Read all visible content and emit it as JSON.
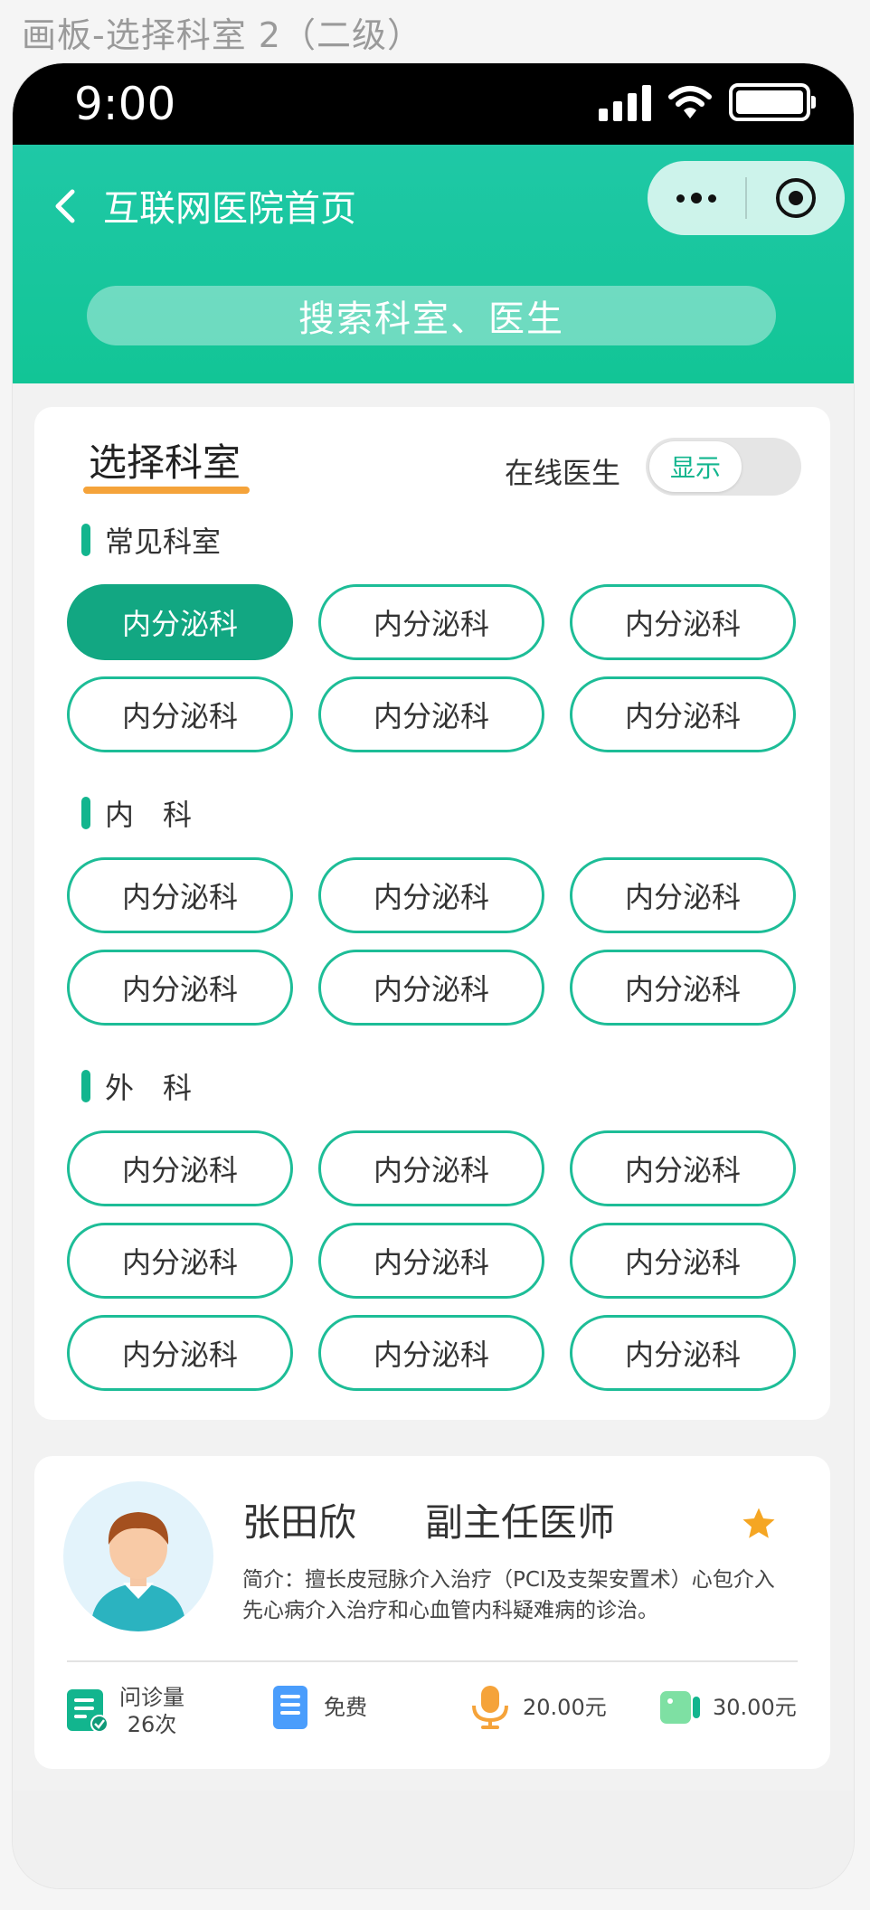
{
  "artboard": {
    "title": "画板-选择科室 2（二级）"
  },
  "status_bar": {
    "time": "9:00"
  },
  "nav": {
    "title": "互联网医院首页",
    "back_icon": "chevron-left-icon",
    "more_icon": "more-dots-icon",
    "close_icon": "target-circle-icon"
  },
  "search": {
    "placeholder": "搜索科室、医生"
  },
  "department": {
    "title": "选择科室",
    "online_label": "在线医生",
    "toggle_text": "显示",
    "sections": [
      {
        "label": "常见科室",
        "items": [
          "内分泌科",
          "内分泌科",
          "内分泌科",
          "内分泌科",
          "内分泌科",
          "内分泌科"
        ]
      },
      {
        "label": "内　科",
        "items": [
          "内分泌科",
          "内分泌科",
          "内分泌科",
          "内分泌科",
          "内分泌科",
          "内分泌科"
        ]
      },
      {
        "label": "外　科",
        "items": [
          "内分泌科",
          "内分泌科",
          "内分泌科",
          "内分泌科",
          "内分泌科",
          "内分泌科",
          "内分泌科",
          "内分泌科",
          "内分泌科"
        ]
      }
    ]
  },
  "doctor": {
    "name": "张田欣",
    "title": "副主任医师",
    "intro": "简介：擅长皮冠脉介入治疗（PCI及支架安置术）心包介入 先心病介入治疗和心血管内科疑难病的诊治。",
    "stats": {
      "consult_label": "问诊量",
      "consult_count": "26次",
      "free": "免费",
      "voice_price": "20.00元",
      "video_price": "30.00元"
    }
  },
  "colors": {
    "primary": "#12b58e",
    "header": "#1fc8a6",
    "accent": "#f5a33a"
  }
}
